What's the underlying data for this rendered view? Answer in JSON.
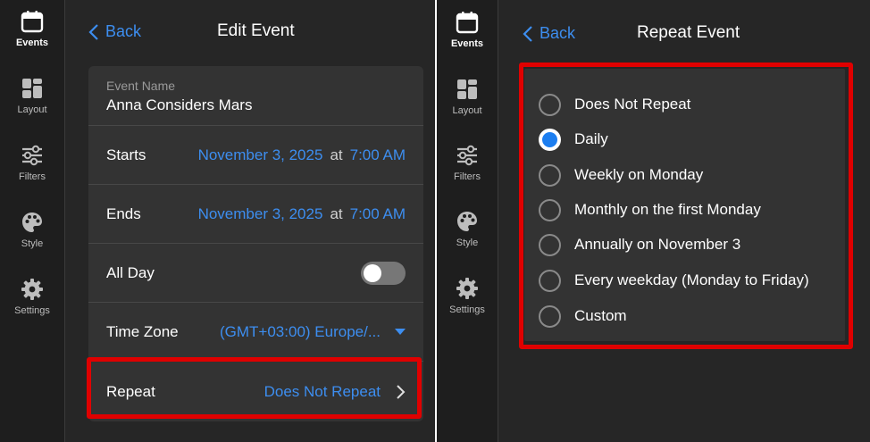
{
  "nav": {
    "items": [
      {
        "label": "Events",
        "icon": "calendar-icon"
      },
      {
        "label": "Layout",
        "icon": "layout-grid-icon"
      },
      {
        "label": "Filters",
        "icon": "sliders-icon"
      },
      {
        "label": "Style",
        "icon": "palette-icon"
      },
      {
        "label": "Settings",
        "icon": "gear-icon"
      }
    ],
    "active": "Events"
  },
  "edit_event": {
    "back_label": "Back",
    "title": "Edit Event",
    "event_name_caption": "Event Name",
    "event_name_value": "Anna Considers Mars",
    "starts": {
      "label": "Starts",
      "date": "November 3, 2025",
      "at": "at",
      "time": "7:00 AM"
    },
    "ends": {
      "label": "Ends",
      "date": "November 3, 2025",
      "at": "at",
      "time": "7:00 AM"
    },
    "all_day": {
      "label": "All Day",
      "on": false
    },
    "time_zone": {
      "label": "Time Zone",
      "value": "(GMT+03:00) Europe/..."
    },
    "repeat": {
      "label": "Repeat",
      "value": "Does Not Repeat"
    }
  },
  "repeat_event": {
    "back_label": "Back",
    "title": "Repeat Event",
    "options": [
      "Does Not Repeat",
      "Daily",
      "Weekly on Monday",
      "Monthly on the first Monday",
      "Annually on November 3",
      "Every weekday (Monday to Friday)",
      "Custom"
    ],
    "selected": "Daily"
  },
  "colors": {
    "accent": "#3d8ef0",
    "radio_selected": "#1c7ef0",
    "highlight": "#e00000",
    "background": "#262626",
    "card": "#333333",
    "sidebar": "#1e1e1e"
  }
}
